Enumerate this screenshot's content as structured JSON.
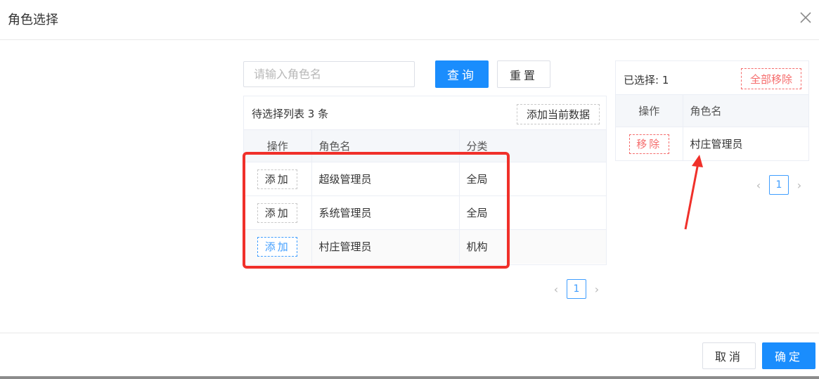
{
  "dialog": {
    "title": "角色选择"
  },
  "search": {
    "placeholder": "请输入角色名",
    "value": "",
    "query_label": "查询",
    "reset_label": "重置"
  },
  "candidates": {
    "title": "待选择列表 3 条",
    "add_all_label": "添加当前数据",
    "columns": [
      "操作",
      "角色名",
      "分类"
    ],
    "rows": [
      {
        "action": "添加",
        "name": "超级管理员",
        "category": "全局"
      },
      {
        "action": "添加",
        "name": "系统管理员",
        "category": "全局"
      },
      {
        "action": "添加",
        "name": "村庄管理员",
        "category": "机构"
      }
    ],
    "pager": {
      "prev": "‹",
      "page": "1",
      "next": "›"
    }
  },
  "selected": {
    "title": "已选择: 1",
    "remove_all_label": "全部移除",
    "columns": [
      "操作",
      "角色名"
    ],
    "rows": [
      {
        "action": "移除",
        "name": "村庄管理员"
      }
    ],
    "pager": {
      "prev": "‹",
      "page": "1",
      "next": "›"
    }
  },
  "footer": {
    "cancel_label": "取消",
    "confirm_label": "确定"
  },
  "colors": {
    "primary": "#1a8dfd",
    "danger": "#f56c6c",
    "annotation": "#f0302a"
  },
  "icons": {
    "close": "close-icon",
    "prev": "chevron-left-icon",
    "next": "chevron-right-icon"
  }
}
